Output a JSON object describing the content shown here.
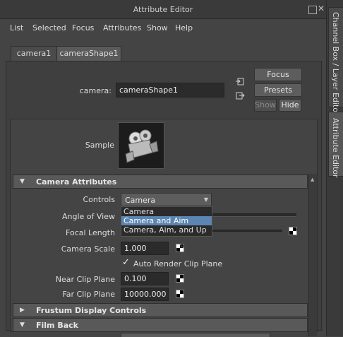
{
  "window": {
    "title": "Attribute Editor"
  },
  "menubar": [
    "List",
    "Selected",
    "Focus",
    "Attributes",
    "Show",
    "Help"
  ],
  "tabs": [
    {
      "label": "camera1",
      "active": false
    },
    {
      "label": "cameraShape1",
      "active": true
    }
  ],
  "header": {
    "node_label": "camera:",
    "node_value": "cameraShape1",
    "focus_label": "Focus",
    "presets_label": "Presets",
    "show_label": "Show",
    "hide_label": "Hide"
  },
  "sample": {
    "label": "Sample"
  },
  "dock_tabs": [
    {
      "label": "Channel Box / Layer Editor",
      "active": false
    },
    {
      "label": "Attribute Editor",
      "active": true
    }
  ],
  "sections": {
    "camera_attributes": "Camera Attributes",
    "frustum": "Frustum Display Controls",
    "film_back": "Film Back"
  },
  "attrs": {
    "controls_label": "Controls",
    "controls_value": "Camera",
    "controls_options": [
      "Camera",
      "Camera and Aim",
      "Camera, Aim, and Up"
    ],
    "controls_selected_index": 1,
    "angle_of_view_label": "Angle of View",
    "focal_length_label": "Focal Length",
    "camera_scale_label": "Camera Scale",
    "camera_scale_value": "1.000",
    "auto_render_label": "Auto Render Clip Plane",
    "auto_render_checked": true,
    "near_clip_label": "Near Clip Plane",
    "near_clip_value": "0.100",
    "far_clip_label": "Far Clip Plane",
    "far_clip_value": "10000.000"
  }
}
